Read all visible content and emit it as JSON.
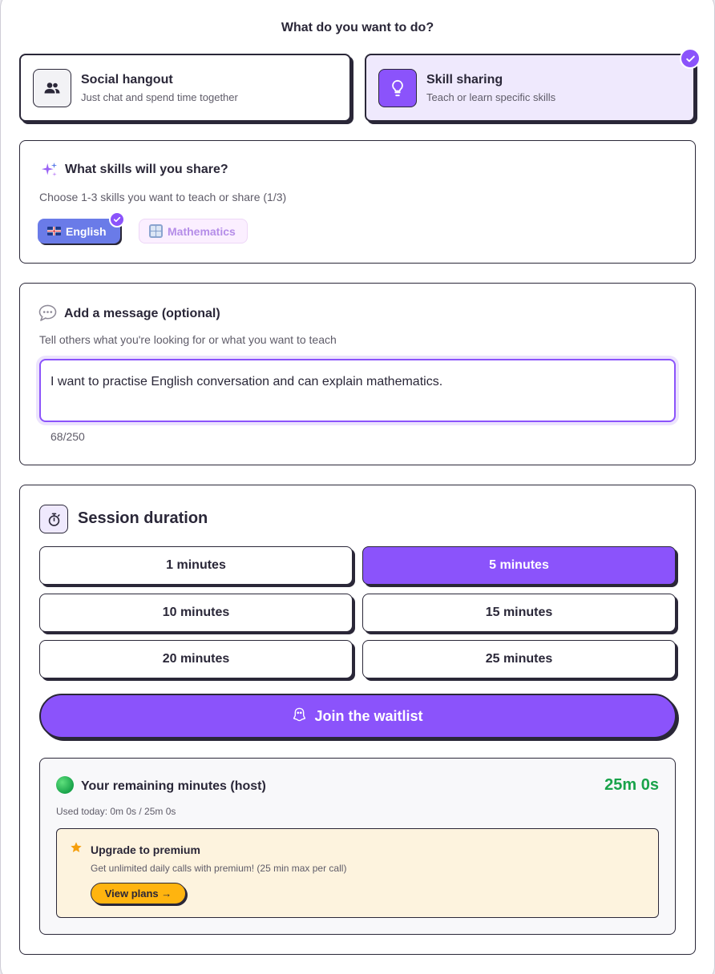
{
  "heading": "What do you want to do?",
  "modes": {
    "social": {
      "title": "Social hangout",
      "desc": "Just chat and spend time together",
      "icon": "people-icon"
    },
    "skill": {
      "title": "Skill sharing",
      "desc": "Teach or learn specific skills",
      "icon": "lightbulb-icon",
      "selected": true
    }
  },
  "skills": {
    "title": "What skills will you share?",
    "subtitle": "Choose 1-3 skills you want to teach or share (1/3)",
    "chips": [
      {
        "label": "English",
        "icon": "uk-flag-icon",
        "selected": true
      },
      {
        "label": "Mathematics",
        "icon": "numbers-icon",
        "selected": false
      }
    ]
  },
  "message": {
    "title": "Add a message (optional)",
    "subtitle": "Tell others what you're looking for or what you want to teach",
    "value": "I want to practise English conversation and can explain mathematics.",
    "counter": "68/250"
  },
  "duration": {
    "title": "Session duration",
    "options": [
      "1 minutes",
      "5 minutes",
      "10 minutes",
      "15 minutes",
      "20 minutes",
      "25 minutes"
    ],
    "selected": "5 minutes"
  },
  "join_label": "Join the waitlist",
  "remaining": {
    "title": "Your remaining minutes (host)",
    "value": "25m 0s",
    "used": "Used today: 0m 0s / 25m 0s"
  },
  "premium": {
    "title": "Upgrade to premium",
    "desc": "Get unlimited daily calls with premium! (25 min max per call)",
    "button": "View plans →"
  },
  "colors": {
    "accent": "#8b53fb",
    "ink": "#2a2738",
    "selected_chip": "#6a7be8",
    "green": "#19a34a",
    "amber": "#ffb40f",
    "premium_bg": "#fdf3de"
  }
}
